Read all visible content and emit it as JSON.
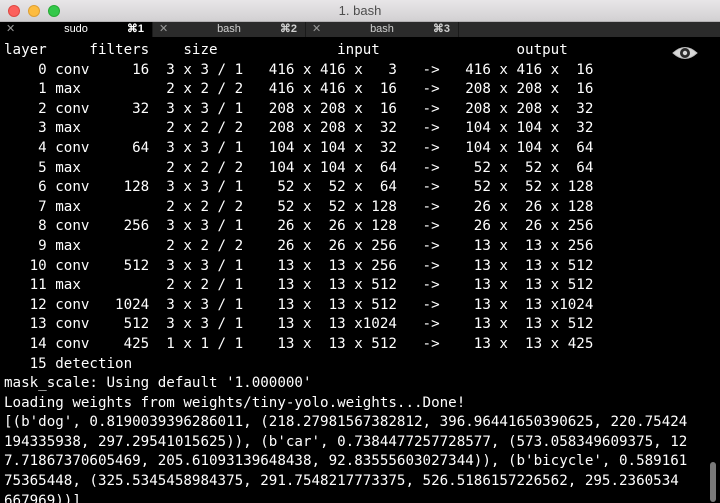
{
  "window": {
    "title": "1. bash"
  },
  "tabs": [
    {
      "label": "sudo",
      "shortcut": "⌘1",
      "close": "✕",
      "active": true
    },
    {
      "label": "bash",
      "shortcut": "⌘2",
      "close": "✕",
      "active": false
    },
    {
      "label": "bash",
      "shortcut": "⌘3",
      "close": "✕",
      "active": false
    }
  ],
  "terminal": {
    "lines": [
      "layer     filters    size              input                output",
      "    0 conv     16  3 x 3 / 1   416 x 416 x   3   ->   416 x 416 x  16",
      "    1 max          2 x 2 / 2   416 x 416 x  16   ->   208 x 208 x  16",
      "    2 conv     32  3 x 3 / 1   208 x 208 x  16   ->   208 x 208 x  32",
      "    3 max          2 x 2 / 2   208 x 208 x  32   ->   104 x 104 x  32",
      "    4 conv     64  3 x 3 / 1   104 x 104 x  32   ->   104 x 104 x  64",
      "    5 max          2 x 2 / 2   104 x 104 x  64   ->    52 x  52 x  64",
      "    6 conv    128  3 x 3 / 1    52 x  52 x  64   ->    52 x  52 x 128",
      "    7 max          2 x 2 / 2    52 x  52 x 128   ->    26 x  26 x 128",
      "    8 conv    256  3 x 3 / 1    26 x  26 x 128   ->    26 x  26 x 256",
      "    9 max          2 x 2 / 2    26 x  26 x 256   ->    13 x  13 x 256",
      "   10 conv    512  3 x 3 / 1    13 x  13 x 256   ->    13 x  13 x 512",
      "   11 max          2 x 2 / 1    13 x  13 x 512   ->    13 x  13 x 512",
      "   12 conv   1024  3 x 3 / 1    13 x  13 x 512   ->    13 x  13 x1024",
      "   13 conv    512  3 x 3 / 1    13 x  13 x1024   ->    13 x  13 x 512",
      "   14 conv    425  1 x 1 / 1    13 x  13 x 512   ->    13 x  13 x 425",
      "   15 detection",
      "mask_scale: Using default '1.000000'",
      "Loading weights from weights/tiny-yolo.weights...Done!",
      "[(b'dog', 0.8190039396286011, (218.27981567382812, 396.96441650390625, 220.75424",
      "194335938, 297.29541015625)), (b'car', 0.7384477257728577, (573.058349609375, 12",
      "7.71867370605469, 205.61093139648438, 92.83555603027344)), (b'bicycle', 0.589161",
      "75365448, (325.5345458984375, 291.7548217773375, 526.5186157226562, 295.2360534",
      "667969))]"
    ]
  },
  "icons": {
    "eye": "eye-icon"
  }
}
